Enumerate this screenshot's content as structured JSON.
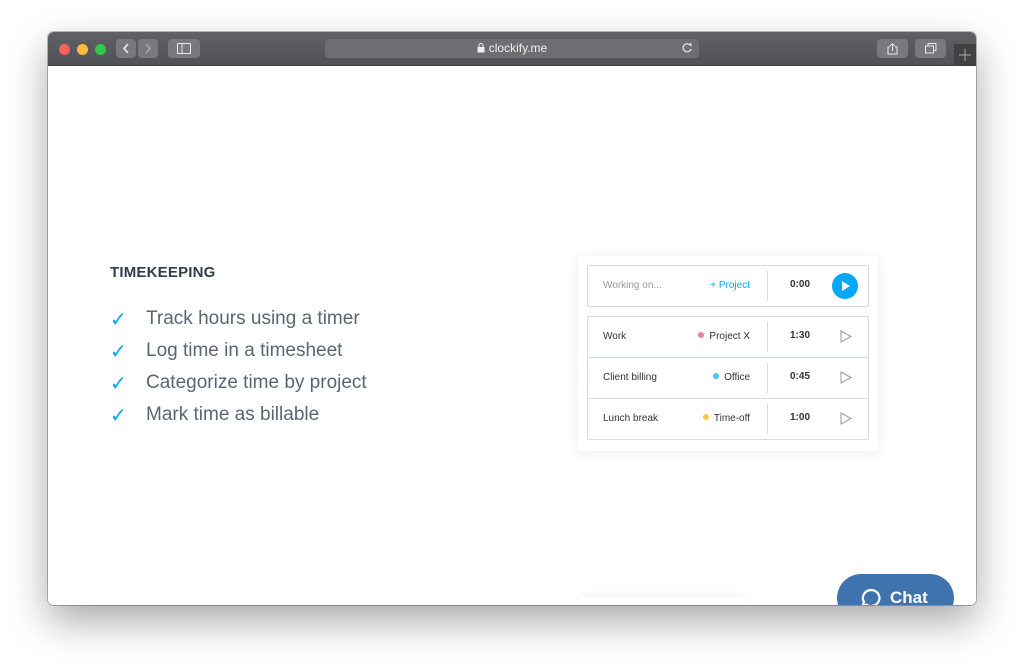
{
  "browser": {
    "url": "clockify.me",
    "icons": [
      "back-arrow-icon",
      "forward-arrow-icon",
      "sidebar-icon",
      "lock-icon",
      "reload-icon",
      "share-icon",
      "tabs-icon",
      "new-tab-icon"
    ]
  },
  "section": {
    "heading": "TIMEKEEPING",
    "check_glyph": "✓",
    "features": [
      "Track hours using a timer",
      "Log time in a timesheet",
      "Categorize time by project",
      "Mark time as billable"
    ]
  },
  "tracker": {
    "input": {
      "placeholder": "Working on...",
      "project_label": "+ Project",
      "time": "0:00"
    },
    "entries": [
      {
        "description": "Work",
        "project": "Project X",
        "project_color": "#e5819b",
        "duration": "1:30"
      },
      {
        "description": "Client billing",
        "project": "Office",
        "project_color": "#4fc3f7",
        "duration": "0:45"
      },
      {
        "description": "Lunch break",
        "project": "Time-off",
        "project_color": "#f7c948",
        "duration": "1:00"
      }
    ]
  },
  "chat": {
    "label": "Chat"
  },
  "colors": {
    "accent": "#03a9f4",
    "chat": "#3f73ad",
    "heading": "#333c4a",
    "text": "#5b6575"
  }
}
